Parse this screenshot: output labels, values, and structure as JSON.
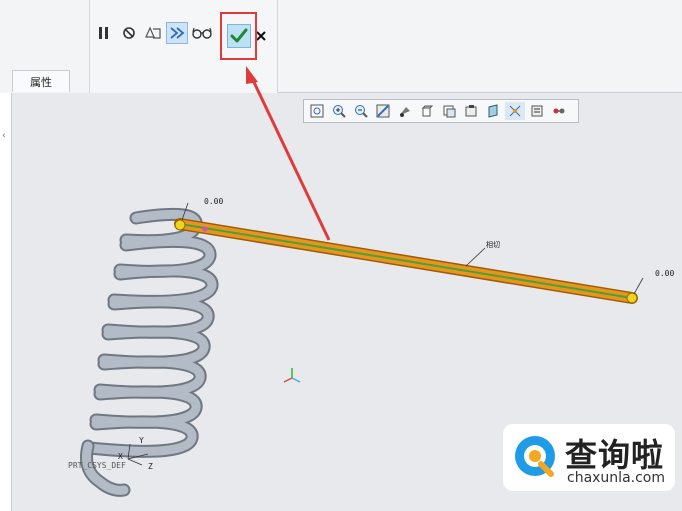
{
  "ribbon": {
    "tabs": [
      {
        "label": "属性"
      }
    ]
  },
  "toolbar": {
    "pause": "pause-icon",
    "no_preview": "no-preview-icon",
    "verify": "verify-icon",
    "toggle_geometry": "toggle-geometry-icon",
    "glasses": "glasses-icon",
    "confirm": "checkmark-icon",
    "cancel": "close-icon"
  },
  "view_toolbar": {
    "icons": [
      "zoom-fit-icon",
      "zoom-in-icon",
      "zoom-out-icon",
      "repaint-icon",
      "orient-icon",
      "saved-views-icon",
      "display-style-icon",
      "perspective-icon",
      "section-icon",
      "datum-display-icon",
      "annotation-display-icon",
      "spin-center-icon"
    ]
  },
  "graphics": {
    "dim_start": "0.00",
    "dim_end": "0.00",
    "tangent_label": "相切",
    "csys_label": "PRT_CSYS_DEF",
    "csys_x": "X",
    "csys_y": "Y",
    "csys_z": "Z"
  },
  "watermark": {
    "chinese": "查询啦",
    "domain": "chaxunla.com"
  },
  "colors": {
    "accent_red": "#e03b3b",
    "sweep_orange": "#e7951c",
    "trajectory_green": "#4aa13a",
    "spring_gray": "#9aa3ad"
  }
}
